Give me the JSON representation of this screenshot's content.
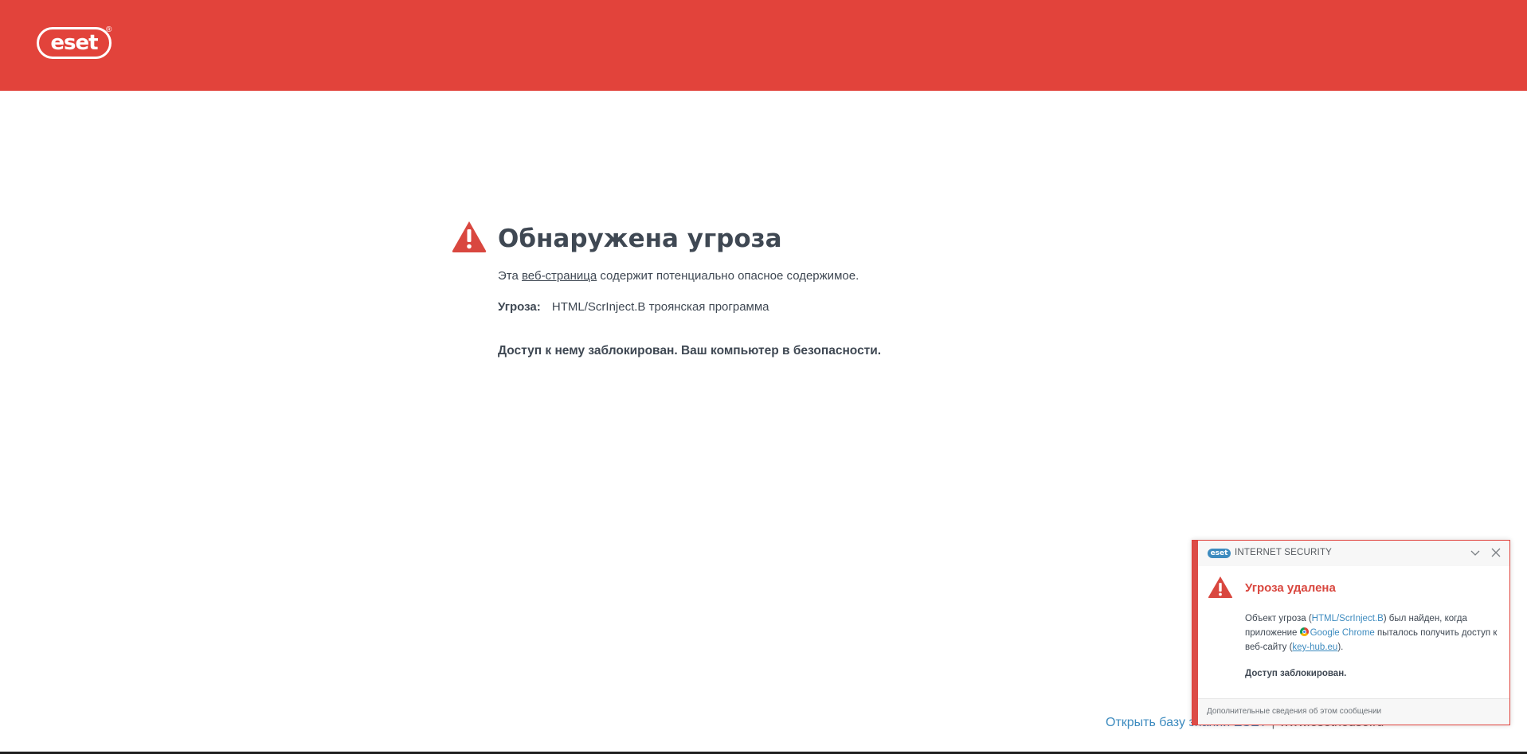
{
  "header": {
    "logo_text": "eset",
    "logo_reg": "®",
    "brand_color": "#e2433b"
  },
  "main": {
    "title": "Обнаружена угроза",
    "desc_before": "Эта ",
    "desc_link": "веб-страница",
    "desc_after": " содержит потенциально опасное содержимое.",
    "threat_label": "Угроза:",
    "threat_value": "HTML/ScrInject.B троянская программа",
    "blocked_text": "Доступ к нему заблокирован. Ваш компьютер в безопасности."
  },
  "footer": {
    "kb_link": "Открыть базу знаний ESET",
    "separator": "|",
    "site_link": "www.esethouse.ru"
  },
  "notification": {
    "mini_logo": "eset",
    "product": "INTERNET SECURITY",
    "title": "Угроза удалена",
    "body_1": "Объект угроза (",
    "threat_link": "HTML/ScrInject.B",
    "body_2": ") был найден, когда приложение ",
    "app_name": "Google Chrome",
    "body_3": " пыталось получить доступ к веб-сайту (",
    "site": "key-hub.eu",
    "body_4": ").",
    "blocked": "Доступ заблокирован.",
    "more_info": "Дополнительные сведения об этом сообщении",
    "icons": {
      "collapse": "chevron-down-icon",
      "close": "close-icon",
      "warning": "warning-icon"
    }
  }
}
